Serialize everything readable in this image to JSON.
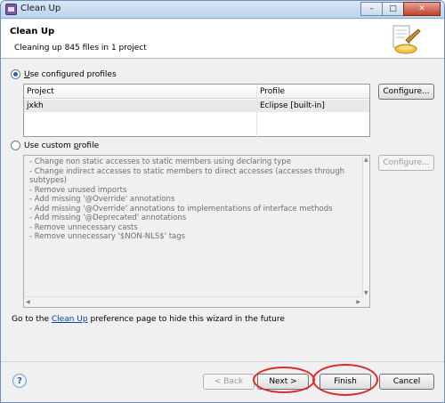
{
  "window": {
    "title": "Clean Up"
  },
  "banner": {
    "heading": "Clean Up",
    "subheading": "Cleaning up 845 files in 1 project"
  },
  "configured": {
    "label_u": "U",
    "label_rest": "se configured profiles",
    "columns": [
      "Project",
      "Profile"
    ],
    "rows": [
      {
        "project": "jxkh",
        "profile": "Eclipse [built-in]"
      }
    ],
    "configure_button": "Configure..."
  },
  "custom": {
    "label_pre": "Use custom ",
    "label_u": "p",
    "label_rest": "rofile",
    "configure_button": "Configure...",
    "items": [
      "Change non static accesses to static members using declaring type",
      "Change indirect accesses to static members to direct accesses (accesses through subtypes)",
      "Remove unused imports",
      "Add missing '@Override' annotations",
      "Add missing '@Override' annotations to implementations of interface methods",
      "Add missing '@Deprecated' annotations",
      "Remove unnecessary casts",
      "Remove unnecessary '$NON-NLS$' tags"
    ]
  },
  "footer": {
    "text_before": "Go to the ",
    "link": "Clean Up",
    "text_after": " preference page to hide this wizard in the future"
  },
  "buttons": {
    "help": "?",
    "back": "< Back",
    "next": "Next >",
    "finish": "Finish",
    "cancel": "Cancel"
  },
  "window_controls": {
    "minimize": "–",
    "maximize": "□",
    "close": "✕"
  },
  "colors": {
    "highlight_oval": "#e0282a",
    "link": "#0645ad"
  }
}
